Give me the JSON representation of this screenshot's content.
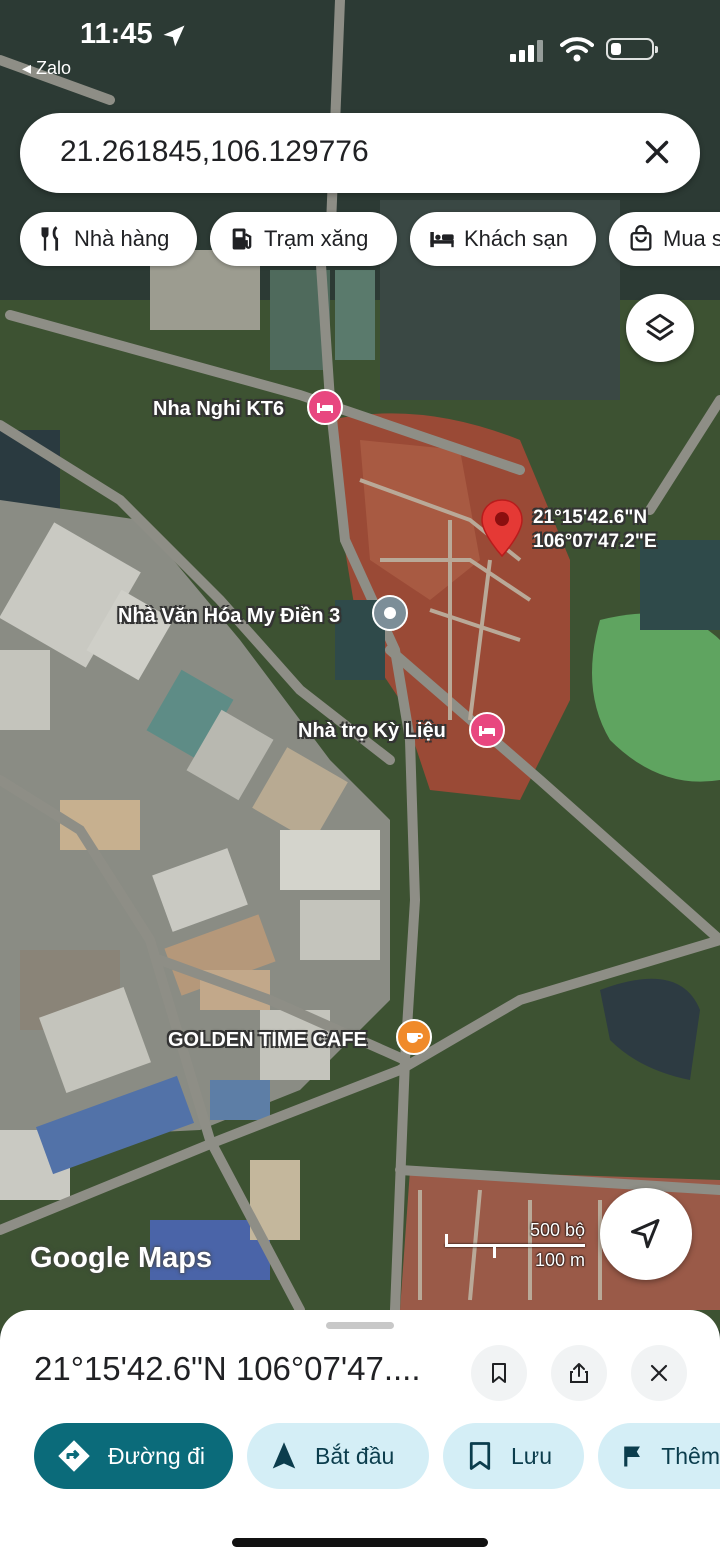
{
  "status_bar": {
    "time": "11:45",
    "back_app": "◂ Zalo"
  },
  "search": {
    "value": "21.261845,106.129776"
  },
  "chips": [
    {
      "label": "Nhà hàng",
      "icon": "restaurant-icon"
    },
    {
      "label": "Trạm xăng",
      "icon": "gas-station-icon"
    },
    {
      "label": "Khách sạn",
      "icon": "hotel-icon"
    },
    {
      "label": "Mua s",
      "icon": "shopping-bag-icon"
    }
  ],
  "map": {
    "places": {
      "nha_nghi": "Nha Nghi KT6",
      "nha_van_hoa": "Nhà Văn Hóa My Điền 3",
      "nha_tro": "Nhà trọ Kỳ Liệu",
      "cafe": "GOLDEN TIME CAFE"
    },
    "pin_lat": "21°15'42.6\"N",
    "pin_lng": "106°07'47.2\"E",
    "attribution": "Google Maps",
    "scale_imperial": "500 bộ",
    "scale_metric": "100 m"
  },
  "sheet": {
    "title": "21°15'42.6\"N 106°07'47....",
    "actions": [
      {
        "label": "Đường đi",
        "icon": "directions-icon"
      },
      {
        "label": "Bắt đầu",
        "icon": "navigation-arrow-icon"
      },
      {
        "label": "Lưu",
        "icon": "bookmark-icon"
      },
      {
        "label": "Thêm",
        "icon": "flag-icon"
      }
    ]
  },
  "colors": {
    "pin_red": "#e53935",
    "hotel_pink": "#e8477f",
    "cafe_orange": "#f08a2a",
    "primary_teal": "#0b6b7a",
    "action_light": "#d4eef6"
  }
}
